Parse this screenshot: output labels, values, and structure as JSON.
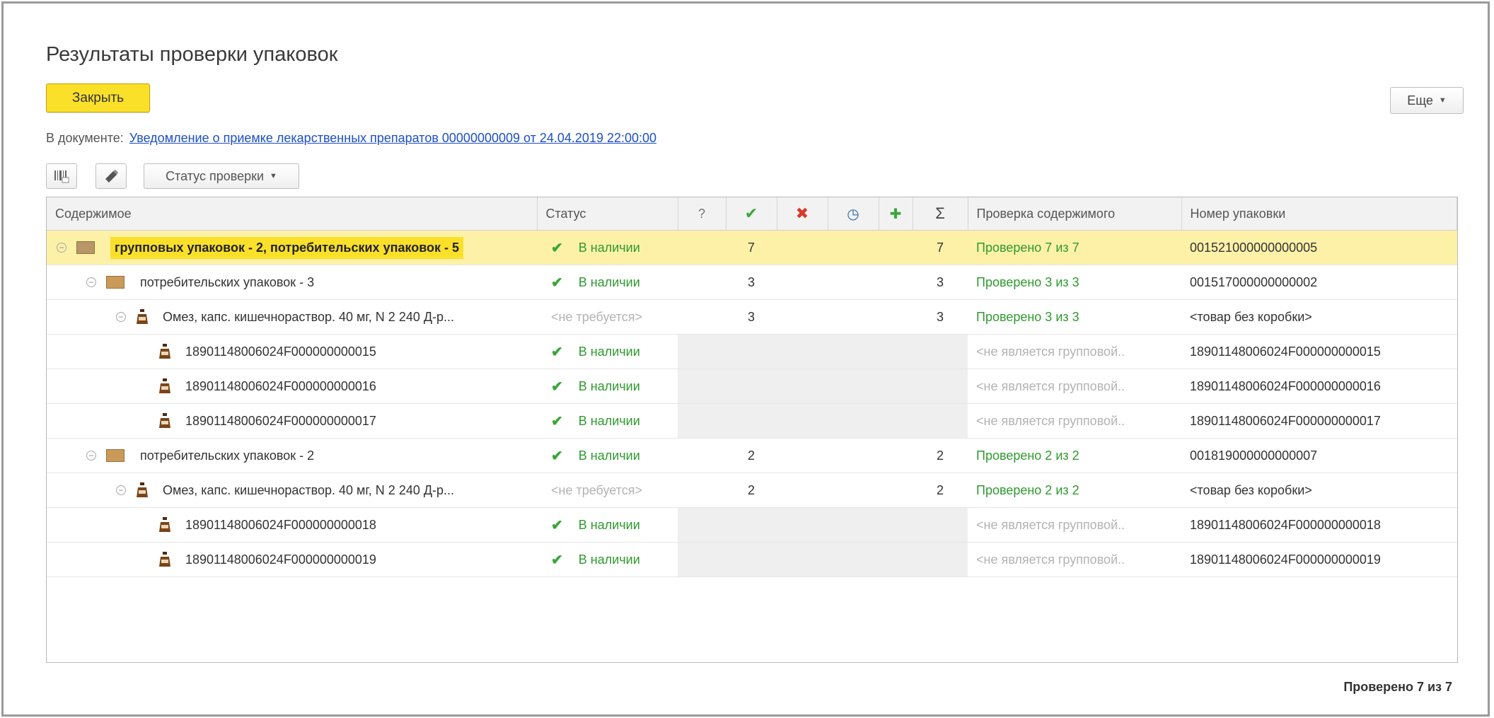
{
  "window": {
    "title": "Результаты проверки упаковок"
  },
  "toolbar": {
    "close_label": "Закрыть",
    "more_label": "Еще",
    "status_filter_label": "Статус проверки"
  },
  "document": {
    "prefix": "В документе:",
    "link": "Уведомление о приемке лекарственных препаратов 00000000009 от 24.04.2019 22:00:00"
  },
  "table": {
    "headers": {
      "content": "Содержимое",
      "status": "Статус",
      "unknown": "?",
      "found": "✔",
      "missing": "✖",
      "pending": "◷",
      "extra": "✚",
      "total": "Σ",
      "content_check": "Проверка содержимого",
      "package_number": "Номер упаковки"
    },
    "rows": [
      {
        "content": "групповых упаковок - 2, потребительских упаковок - 5",
        "status": "В наличии",
        "found": "7",
        "total": "7",
        "content_check": "Проверено 7 из 7",
        "package_number": "001521000000000005"
      },
      {
        "content": "потребительских упаковок - 3",
        "status": "В наличии",
        "found": "3",
        "total": "3",
        "content_check": "Проверено 3 из 3",
        "package_number": "001517000000000002"
      },
      {
        "content": "Омез, капс. кишечнораствор. 40 мг, N 2 240 Д-р...",
        "status": "<не требуется>",
        "found": "3",
        "total": "3",
        "content_check": "Проверено 3 из 3",
        "package_number": "<товар без коробки>"
      },
      {
        "content": "18901148006024F000000000015",
        "status": "В наличии",
        "content_check": "<не является групповой..",
        "package_number": "18901148006024F000000000015"
      },
      {
        "content": "18901148006024F000000000016",
        "status": "В наличии",
        "content_check": "<не является групповой..",
        "package_number": "18901148006024F000000000016"
      },
      {
        "content": "18901148006024F000000000017",
        "status": "В наличии",
        "content_check": "<не является групповой..",
        "package_number": "18901148006024F000000000017"
      },
      {
        "content": "потребительских упаковок - 2",
        "status": "В наличии",
        "found": "2",
        "total": "2",
        "content_check": "Проверено 2 из 2",
        "package_number": "001819000000000007"
      },
      {
        "content": "Омез, капс. кишечнораствор. 40 мг, N 2 240 Д-р...",
        "status": "<не требуется>",
        "found": "2",
        "total": "2",
        "content_check": "Проверено 2 из 2",
        "package_number": "<товар без коробки>"
      },
      {
        "content": "18901148006024F000000000018",
        "status": "В наличии",
        "content_check": "<не является групповой..",
        "package_number": "18901148006024F000000000018"
      },
      {
        "content": "18901148006024F000000000019",
        "status": "В наличии",
        "content_check": "<не является групповой..",
        "package_number": "18901148006024F000000000019"
      }
    ]
  },
  "footer": {
    "summary": "Проверено 7 из 7"
  },
  "colors": {
    "accent_yellow": "#fbe02a",
    "selected_row": "#fdf1a8",
    "status_green": "#2f9a2f",
    "link_blue": "#1c4fc6",
    "missing_red": "#d63a2a"
  }
}
